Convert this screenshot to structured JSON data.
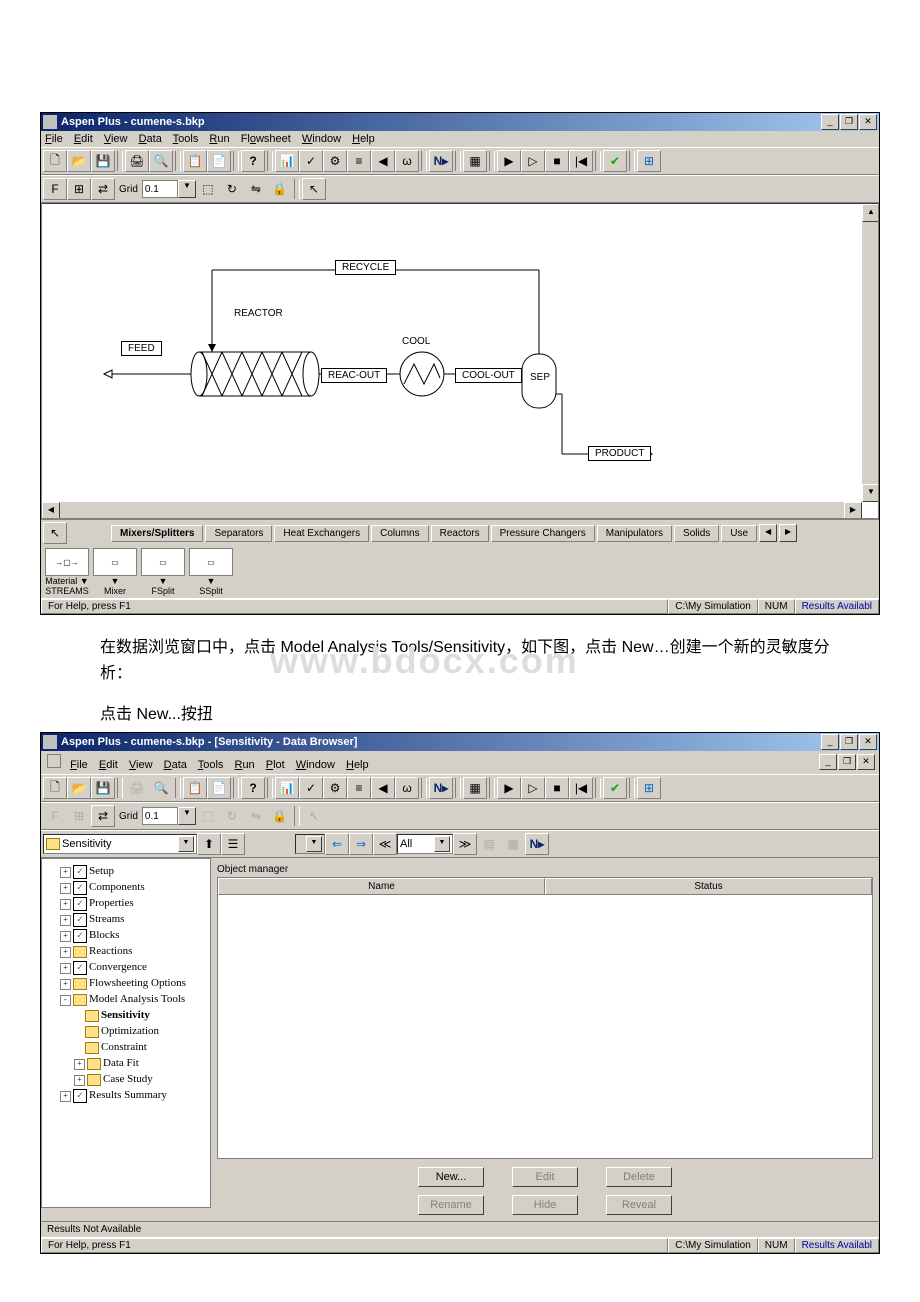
{
  "win1": {
    "title": "Aspen Plus - cumene-s.bkp",
    "menus": [
      "File",
      "Edit",
      "View",
      "Data",
      "Tools",
      "Run",
      "Flowsheet",
      "Window",
      "Help"
    ],
    "grid_label": "Grid",
    "grid_value": "0.1",
    "flow": {
      "recycle": "RECYCLE",
      "reactor": "REACTOR",
      "feed": "FEED",
      "reac_out": "REAC-OUT",
      "cool": "COOL",
      "cool_out": "COOL-OUT",
      "sep": "SEP",
      "product": "PRODUCT"
    },
    "tabs": [
      "Mixers/Splitters",
      "Separators",
      "Heat Exchangers",
      "Columns",
      "Reactors",
      "Pressure Changers",
      "Manipulators",
      "Solids",
      "Use"
    ],
    "palette": {
      "streams": "STREAMS",
      "material": "Material",
      "mixer": "Mixer",
      "fsplit": "FSplit",
      "ssplit": "SSplit"
    },
    "status": {
      "help": "For Help, press F1",
      "path": "C:\\My Simulation",
      "num": "NUM",
      "avail": "Results Availabl"
    }
  },
  "narr1": "在数据浏览窗口中，点击 Model Analysis Tools/Sensitivity，如下图，点击 New…创建一个新的灵敏度分析：",
  "narr2": "点击 New...按扭",
  "watermark": "www.bdocx.com",
  "win2": {
    "title": "Aspen Plus - cumene-s.bkp - [Sensitivity - Data Browser]",
    "menus": [
      "File",
      "Edit",
      "View",
      "Data",
      "Tools",
      "Run",
      "Plot",
      "Window",
      "Help"
    ],
    "grid_label": "Grid",
    "grid_value": "0.1",
    "combo": "Sensitivity",
    "filter": "All",
    "tree": [
      {
        "l": 0,
        "exp": "+",
        "ck": true,
        "t": "Setup"
      },
      {
        "l": 0,
        "exp": "+",
        "ck": true,
        "t": "Components"
      },
      {
        "l": 0,
        "exp": "+",
        "ck": true,
        "t": "Properties"
      },
      {
        "l": 0,
        "exp": "+",
        "ck": true,
        "t": "Streams"
      },
      {
        "l": 0,
        "exp": "+",
        "ck": true,
        "t": "Blocks"
      },
      {
        "l": 0,
        "exp": "+",
        "fld": true,
        "t": "Reactions"
      },
      {
        "l": 0,
        "exp": "+",
        "ck": true,
        "t": "Convergence"
      },
      {
        "l": 0,
        "exp": "+",
        "fld": true,
        "t": "Flowsheeting Options"
      },
      {
        "l": 0,
        "exp": "-",
        "fld": true,
        "t": "Model Analysis Tools"
      },
      {
        "l": 1,
        "fld": true,
        "bold": true,
        "t": "Sensitivity"
      },
      {
        "l": 1,
        "fld": true,
        "t": "Optimization"
      },
      {
        "l": 1,
        "fld": true,
        "t": "Constraint"
      },
      {
        "l": 1,
        "exp": "+",
        "fld": true,
        "t": "Data Fit"
      },
      {
        "l": 1,
        "exp": "+",
        "fld": true,
        "t": "Case Study"
      },
      {
        "l": 0,
        "exp": "+",
        "ck": true,
        "t": "Results Summary"
      }
    ],
    "objmgr": {
      "label": "Object manager",
      "cols": [
        "Name",
        "Status"
      ]
    },
    "buttons": {
      "new": "New...",
      "edit": "Edit",
      "delete": "Delete",
      "rename": "Rename",
      "hide": "Hide",
      "reveal": "Reveal"
    },
    "status2": "Results Not Available",
    "status": {
      "help": "For Help, press F1",
      "path": "C:\\My Simulation",
      "num": "NUM",
      "avail": "Results Availabl"
    }
  }
}
